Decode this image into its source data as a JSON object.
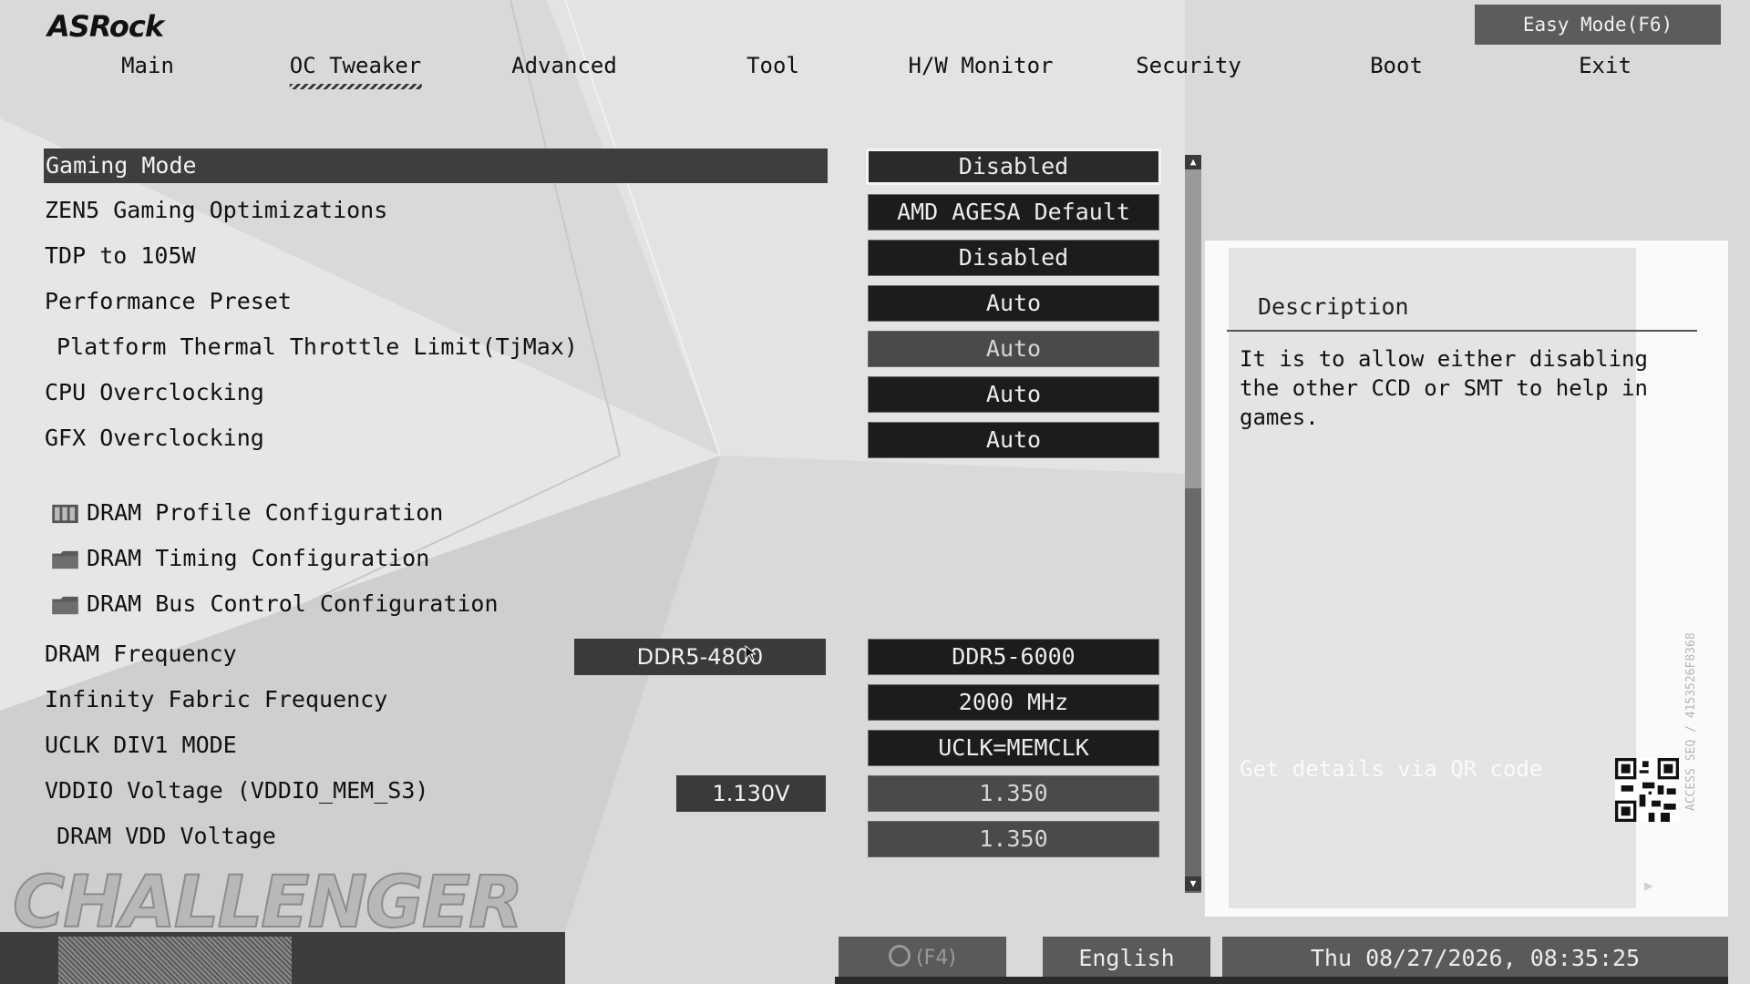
{
  "brand": "ASRock",
  "easy_mode": "Easy Mode(F6)",
  "tabs": [
    "Main",
    "OC Tweaker",
    "Advanced",
    "Tool",
    "H/W Monitor",
    "Security",
    "Boot",
    "Exit"
  ],
  "active_tab": "OC Tweaker",
  "rows": {
    "gaming_mode": {
      "label": "Gaming Mode",
      "value": "Disabled"
    },
    "zen5": {
      "label": "ZEN5 Gaming Optimizations",
      "value": "AMD AGESA Default"
    },
    "tdp": {
      "label": "TDP to 105W",
      "value": "Disabled"
    },
    "perf_preset": {
      "label": "Performance Preset",
      "value": "Auto"
    },
    "tjmax": {
      "label": "Platform Thermal Throttle Limit(TjMax)",
      "value": "Auto"
    },
    "cpu_oc": {
      "label": "CPU Overclocking",
      "value": "Auto"
    },
    "gfx_oc": {
      "label": "GFX Overclocking",
      "value": "Auto"
    },
    "dram_profile": {
      "label": "DRAM Profile Configuration"
    },
    "dram_timing": {
      "label": "DRAM Timing Configuration"
    },
    "dram_bus": {
      "label": "DRAM Bus Control Configuration"
    },
    "dram_freq": {
      "label": "DRAM Frequency",
      "current": "DDR5-4800",
      "value": "DDR5-6000"
    },
    "infinity_fabric": {
      "label": "Infinity Fabric Frequency",
      "value": "2000 MHz"
    },
    "uclk": {
      "label": "UCLK DIV1 MODE",
      "value": "UCLK=MEMCLK"
    },
    "vddio": {
      "label": "VDDIO Voltage (VDDIO_MEM_S3)",
      "current": "1.130V",
      "value": "1.350"
    },
    "dram_vdd": {
      "label": "DRAM VDD Voltage",
      "value": "1.350"
    }
  },
  "description": {
    "title": "Description",
    "text": "It is to allow either disabling the other CCD or SMT to help in games.",
    "qr_hint": "Get details via QR code",
    "side_text": "ACCESS SEQ / 4153526F8368"
  },
  "footer_brand": "CHALLENGER",
  "bottom": {
    "search": "(F4)",
    "language": "English",
    "datetime": "Thu 08/27/2026, 08:35:25"
  },
  "colors": {
    "panel_dark": "#1c1c1c",
    "selected_row": "#3e3e3e",
    "background": "#d9d9d9"
  }
}
